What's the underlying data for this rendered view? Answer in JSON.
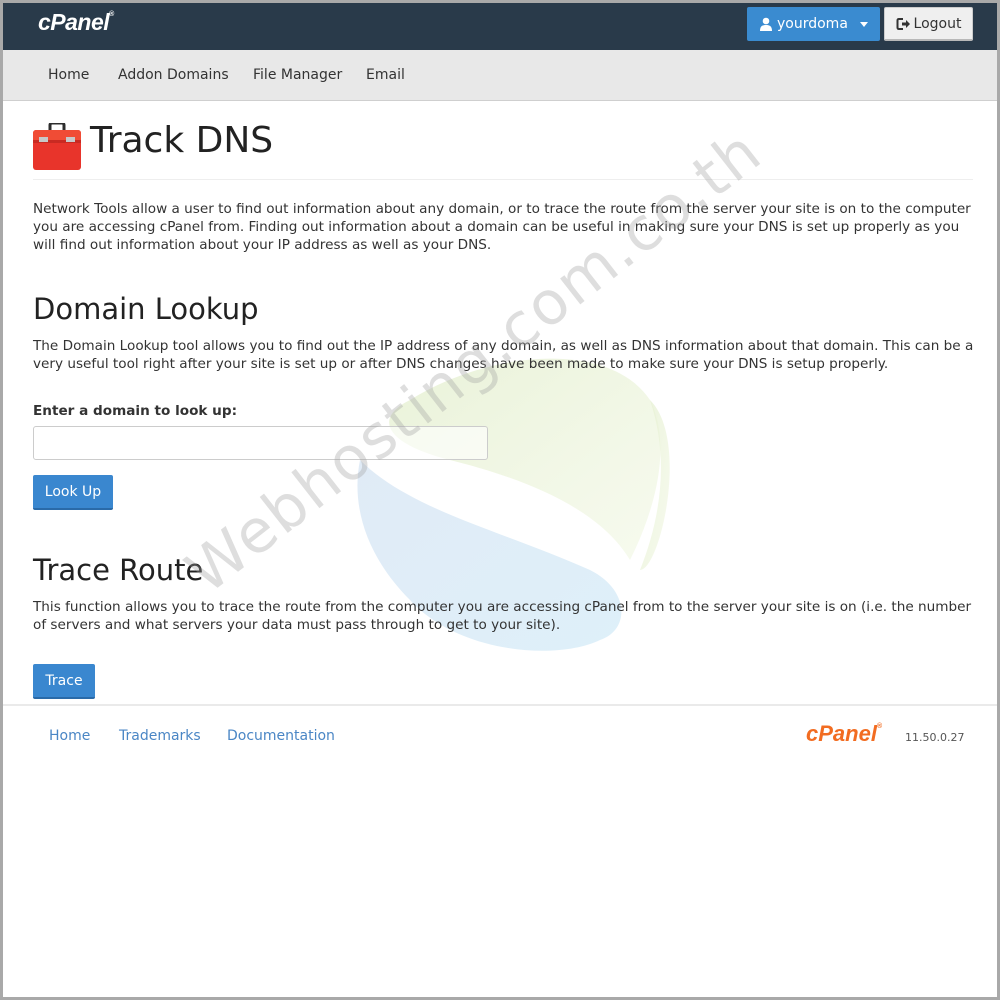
{
  "header": {
    "brand": "cPanel",
    "user_menu_label": "yourdoma",
    "logout_label": "Logout"
  },
  "nav": {
    "items": [
      {
        "label": "Home"
      },
      {
        "label": "Addon Domains"
      },
      {
        "label": "File Manager"
      },
      {
        "label": "Email"
      }
    ]
  },
  "page": {
    "title": "Track DNS",
    "intro": "Network Tools allow a user to find out information about any domain, or to trace the route from the server your site is on to the computer you are accessing cPanel from. Finding out information about a domain can be useful in making sure your DNS is set up properly as you will find out information about your IP address as well as your DNS."
  },
  "domain_lookup": {
    "heading": "Domain Lookup",
    "description": "The Domain Lookup tool allows you to find out the IP address of any domain, as well as DNS information about that domain. This can be a very useful tool right after your site is set up or after DNS changes have been made to make sure your DNS is setup properly.",
    "field_label": "Enter a domain to look up:",
    "input_value": "",
    "input_placeholder": "",
    "button_label": "Look Up"
  },
  "trace_route": {
    "heading": "Trace Route",
    "description": "This function allows you to trace the route from the computer you are accessing cPanel from to the server your site is on (i.e. the number of servers and what servers your data must pass through to get to your site).",
    "button_label": "Trace"
  },
  "footer": {
    "links": [
      {
        "label": "Home"
      },
      {
        "label": "Trademarks"
      },
      {
        "label": "Documentation"
      }
    ],
    "brand": "cPanel",
    "version": "11.50.0.27"
  },
  "watermark": {
    "text": "Webhosting.com.co.th"
  },
  "colors": {
    "topbar": "#293a4a",
    "primary_button": "#3a87cf",
    "link": "#4a86c5",
    "cpanel_orange": "#f26c21"
  }
}
